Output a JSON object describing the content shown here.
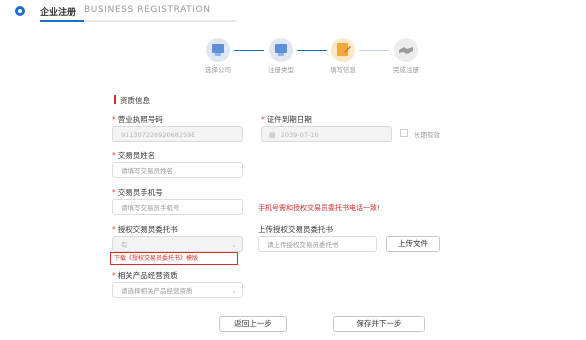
{
  "header": {
    "title_cn": "企业注册",
    "title_en": "BUSINESS REGISTRATION"
  },
  "steps": [
    {
      "label": "选择公司",
      "state": "done",
      "icon": "company-icon"
    },
    {
      "label": "注册类型",
      "state": "done",
      "icon": "type-icon"
    },
    {
      "label": "填写信息",
      "state": "active",
      "icon": "edit-icon"
    },
    {
      "label": "完成注册",
      "state": "pending",
      "icon": "handshake-icon"
    }
  ],
  "section": {
    "title": "资质信息"
  },
  "form": {
    "license_label": "营业执照号码",
    "license_value": "91130722692068259E",
    "expire_label": "证件到期日期",
    "expire_value": "2039-07-16",
    "longterm_label": "长期有效",
    "trader_name_label": "交易员姓名",
    "trader_name_placeholder": "请填写交易员姓名",
    "trader_phone_label": "交易员手机号",
    "trader_phone_placeholder": "请填写交易员手机号",
    "phone_note": "手机号需和授权交易员委托书电话一致!",
    "auth_label": "授权交易员委托书",
    "auth_select_value": "有",
    "upload_label": "上传授权交易员委托书",
    "upload_placeholder": "请上传授权交易员委托书",
    "upload_button": "上传文件",
    "download_link": "下载《授权交易员委托书》模版",
    "product_label": "相关产品经营资质",
    "product_placeholder": "请选择相关产品经营资质"
  },
  "actions": {
    "back": "返回上一步",
    "next": "保存并下一步"
  },
  "colors": {
    "accent": "#1c6fd0",
    "required": "#e0443a",
    "warning": "#d0312d",
    "active_step": "#f2a93b"
  }
}
